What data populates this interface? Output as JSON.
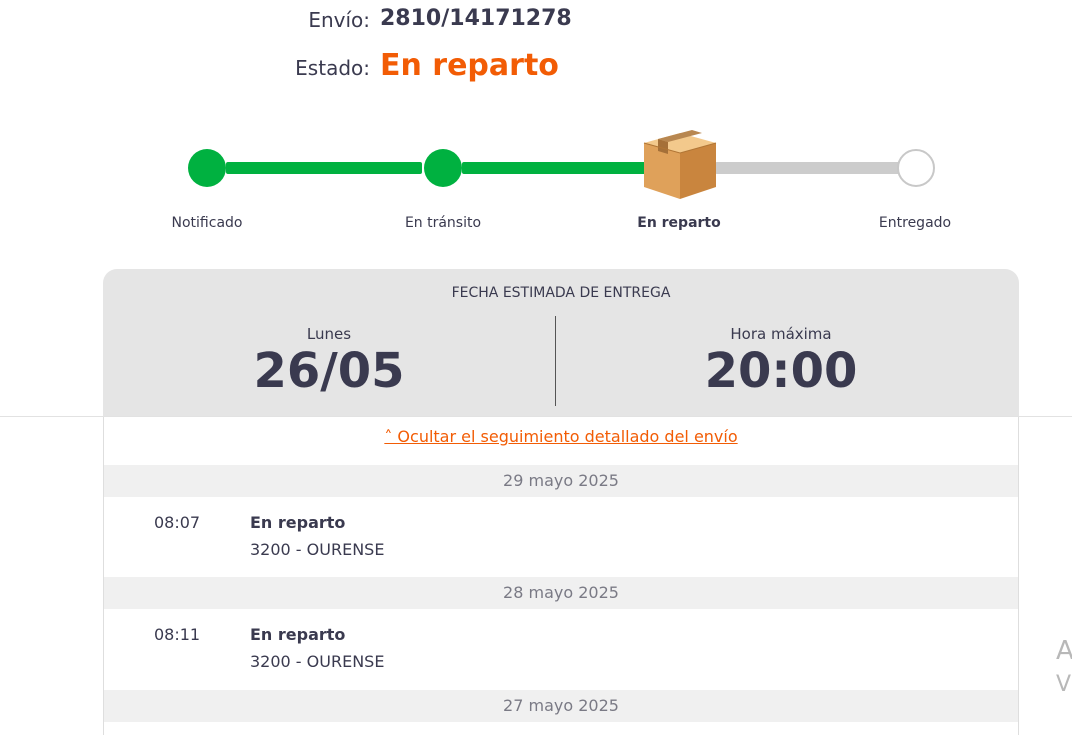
{
  "shipment": {
    "envio_label": "Envío:",
    "envio_value": "2810/14171278",
    "estado_label": "Estado:",
    "estado_value": "En reparto"
  },
  "progress": {
    "steps": [
      {
        "label": "Notificado",
        "state": "done"
      },
      {
        "label": "En tránsito",
        "state": "done"
      },
      {
        "label": "En reparto",
        "state": "current"
      },
      {
        "label": "Entregado",
        "state": "pending"
      }
    ],
    "icons": {
      "current": "package-box-icon"
    },
    "colors": {
      "done": "#00b140",
      "pending": "#cccccc"
    }
  },
  "estimate": {
    "title": "FECHA ESTIMADA DE ENTREGA",
    "day_label": "Lunes",
    "date": "26/05",
    "time_label": "Hora máxima",
    "time": "20:00"
  },
  "detail": {
    "toggle_label": "˄ Ocultar el seguimiento detallado del envío",
    "groups": [
      {
        "date": "29 mayo 2025",
        "events": [
          {
            "time": "08:07",
            "status": "En reparto",
            "place": "3200 - OURENSE"
          }
        ]
      },
      {
        "date": "28 mayo 2025",
        "events": [
          {
            "time": "08:11",
            "status": "En reparto",
            "place": "3200 - OURENSE"
          }
        ]
      },
      {
        "date": "27 mayo 2025",
        "events": []
      }
    ]
  },
  "side_ghost": {
    "line1": "A",
    "line2": "V"
  },
  "colors": {
    "accent": "#f25c05",
    "text": "#3a3a4f",
    "success": "#00b140"
  }
}
